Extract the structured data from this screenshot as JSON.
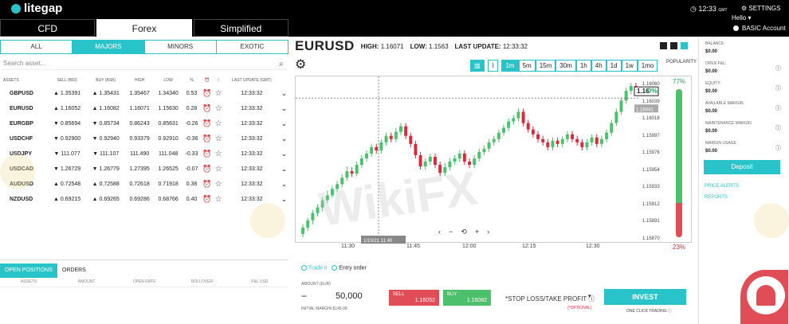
{
  "header": {
    "brand": "litegap",
    "time": "12:33",
    "tz": "GMT",
    "settings_label": "SETTINGS",
    "hello": "Hello",
    "account": "BASIC Account"
  },
  "main_tabs": [
    "CFD",
    "Forex",
    "Simplified"
  ],
  "sub_tabs": [
    "ALL",
    "MAJORS",
    "MINORS",
    "EXOTIC"
  ],
  "search": {
    "placeholder": "Search asset..."
  },
  "columns": [
    "ASSETS",
    "SELL (BID)",
    "BUY (ASK)",
    "HIGH",
    "LOW",
    "%",
    "",
    "",
    "LAST UPDATE (GMT)",
    ""
  ],
  "rows": [
    {
      "sym": "GBPUSD",
      "sell": "1.35391",
      "buy": "1.35431",
      "high": "1.35467",
      "low": "1.34340",
      "pct": "0.53",
      "time": "12:33:32",
      "sdir": "up",
      "bdir": "up"
    },
    {
      "sym": "EURUSD",
      "sell": "1.16052",
      "buy": "1.16082",
      "high": "1.16071",
      "low": "1.15630",
      "pct": "0.28",
      "time": "12:33:32",
      "sdir": "up",
      "bdir": "up"
    },
    {
      "sym": "EURGBP",
      "sell": "0.85694",
      "buy": "0.85734",
      "high": "0.86243",
      "low": "0.85631",
      "pct": "-0.26",
      "time": "12:33:32",
      "sdir": "down",
      "bdir": "down"
    },
    {
      "sym": "USDCHF",
      "sell": "0.92900",
      "buy": "0.92940",
      "high": "0.93379",
      "low": "0.92910",
      "pct": "-0.36",
      "time": "12:33:32",
      "sdir": "down",
      "bdir": "down"
    },
    {
      "sym": "USDJPY",
      "sell": "111.077",
      "buy": "111.107",
      "high": "111.490",
      "low": "111.048",
      "pct": "-0.33",
      "time": "12:33:32",
      "sdir": "down",
      "bdir": "down"
    },
    {
      "sym": "USDCAD",
      "sell": "1.26729",
      "buy": "1.26779",
      "high": "1.27395",
      "low": "1.26525",
      "pct": "-0.07",
      "time": "12:33:32",
      "sdir": "down",
      "bdir": "down"
    },
    {
      "sym": "AUDUSD",
      "sell": "0.72548",
      "buy": "0.72588",
      "high": "0.72618",
      "low": "0.71918",
      "pct": "0.38",
      "time": "12:33:32",
      "sdir": "up",
      "bdir": "up"
    },
    {
      "sym": "NZDUSD",
      "sell": "0.69215",
      "buy": "0.69265",
      "high": "0.69286",
      "low": "0.68766",
      "pct": "0.40",
      "time": "12:33:32",
      "sdir": "up",
      "bdir": "up"
    }
  ],
  "positions": {
    "tabs": [
      "OPEN POSITIONS",
      "ORDERS"
    ],
    "columns": [
      "ASSETS",
      "AMOUNT",
      "OPEN RATE",
      "ROLLOVER",
      "P&L USD"
    ]
  },
  "chart_head": {
    "symbol": "EURUSD",
    "high_label": "HIGH:",
    "high": "1.16071",
    "low_label": "LOW:",
    "low": "1.1563",
    "update_label": "LAST UPDATE:",
    "update": "12:33:32"
  },
  "timeframes": [
    "1m",
    "5m",
    "15m",
    "30m",
    "1h",
    "4h",
    "1d",
    "1w",
    "1mo"
  ],
  "popularity": {
    "label": "POPULARITY",
    "buy_pct": 77,
    "sell_pct": 23,
    "top": "77%",
    "bottom": "23%"
  },
  "order": {
    "tradeit": "Trade it",
    "entry": "Entry order",
    "amount_label": "AMOUNT (EUR)",
    "amount": "50,000",
    "minus": "−",
    "plus": "+",
    "initial_margin": "INITIAL MARGIN $145.08",
    "sell_label": "SELL",
    "sell_price": "1.16052",
    "buy_label": "BUY",
    "buy_price": "1.16082",
    "sltp": "STOP LOSS/TAKE PROFIT",
    "optional": "(*OPTIONAL)",
    "invest": "INVEST",
    "oneclick": "ONE CLICK TRADING"
  },
  "account": {
    "items": [
      {
        "label": "BALANCE:",
        "value": "$0.00"
      },
      {
        "label": "OPEN P&L:",
        "value": "$0.00"
      },
      {
        "label": "EQUITY:",
        "value": "$0.00"
      },
      {
        "label": "AVAILABLE MARGIN",
        "value": "$0.00"
      },
      {
        "label": "MAINTENANCE MARGIN",
        "value": "$0.00"
      },
      {
        "label": "MARGIN USAGE",
        "value": "$0.00"
      }
    ],
    "deposit": "Deposit",
    "price_alerts": "PRICE ALERTS",
    "reports": "REPORTS"
  },
  "watermark": "WikiFX",
  "chart_data": {
    "type": "candlestick",
    "y_ticks": [
      "1.16060",
      "1.16039",
      "1.16018",
      "1.15997",
      "1.15976",
      "1.15954",
      "1.15933",
      "1.15912",
      "1.15891",
      "1.15870"
    ],
    "x_ticks": [
      "11:30",
      "11:45",
      "12:00",
      "12:15",
      "12:30"
    ],
    "last_price_label": "1.16",
    "last_price_pct": "0%",
    "crosshair_price": "1.16041",
    "crosshair_time": "1/10/21 11:40",
    "candles": [
      [
        1.15872,
        1.1588,
        1.15868,
        1.15884
      ],
      [
        1.1588,
        1.15889,
        1.15876,
        1.15892
      ],
      [
        1.15889,
        1.15898,
        1.15884,
        1.15902
      ],
      [
        1.15898,
        1.15905,
        1.15894,
        1.15909
      ],
      [
        1.15905,
        1.15914,
        1.159,
        1.15918
      ],
      [
        1.15914,
        1.1592,
        1.1591,
        1.15926
      ],
      [
        1.1592,
        1.15928,
        1.15917,
        1.15932
      ],
      [
        1.15928,
        1.15934,
        1.15924,
        1.15938
      ],
      [
        1.15934,
        1.15942,
        1.1593,
        1.15946
      ],
      [
        1.15942,
        1.1595,
        1.15938,
        1.15956
      ],
      [
        1.1595,
        1.15947,
        1.15943,
        1.15955
      ],
      [
        1.15947,
        1.15958,
        1.15944,
        1.15962
      ],
      [
        1.15958,
        1.15966,
        1.15954,
        1.1597
      ],
      [
        1.15966,
        1.15972,
        1.15962,
        1.15976
      ],
      [
        1.15972,
        1.1598,
        1.15968,
        1.15984
      ],
      [
        1.1598,
        1.15976,
        1.15972,
        1.15984
      ],
      [
        1.15976,
        1.15986,
        1.15972,
        1.1599
      ],
      [
        1.15986,
        1.15994,
        1.15982,
        1.15998
      ],
      [
        1.15994,
        1.1599,
        1.15986,
        1.15998
      ],
      [
        1.1599,
        1.15999,
        1.15986,
        1.16004
      ],
      [
        1.15999,
        1.16006,
        1.15995,
        1.1601
      ],
      [
        1.16006,
        1.15994,
        1.1599,
        1.1601
      ],
      [
        1.15994,
        1.15984,
        1.1598,
        1.15998
      ],
      [
        1.15984,
        1.1597,
        1.15966,
        1.15988
      ],
      [
        1.1597,
        1.15956,
        1.15952,
        1.15974
      ],
      [
        1.15956,
        1.15962,
        1.15952,
        1.15966
      ],
      [
        1.15962,
        1.15968,
        1.15958,
        1.15972
      ],
      [
        1.15968,
        1.15958,
        1.15954,
        1.15972
      ],
      [
        1.15958,
        1.15948,
        1.15944,
        1.15962
      ],
      [
        1.15948,
        1.15955,
        1.15944,
        1.1596
      ],
      [
        1.15955,
        1.15962,
        1.15951,
        1.15966
      ],
      [
        1.15962,
        1.15966,
        1.15958,
        1.1597
      ],
      [
        1.15966,
        1.15972,
        1.15962,
        1.15976
      ],
      [
        1.15972,
        1.15962,
        1.15958,
        1.15976
      ],
      [
        1.15962,
        1.15958,
        1.15954,
        1.15966
      ],
      [
        1.15958,
        1.15966,
        1.15954,
        1.1597
      ],
      [
        1.15966,
        1.15974,
        1.15962,
        1.15978
      ],
      [
        1.15974,
        1.15978,
        1.1597,
        1.15982
      ],
      [
        1.15978,
        1.15986,
        1.15974,
        1.1599
      ],
      [
        1.15986,
        1.1599,
        1.15982,
        1.15994
      ],
      [
        1.1599,
        1.15998,
        1.15986,
        1.16002
      ],
      [
        1.15998,
        1.16004,
        1.15994,
        1.16008
      ],
      [
        1.16004,
        1.16012,
        1.16,
        1.16016
      ],
      [
        1.16012,
        1.16016,
        1.16008,
        1.1602
      ],
      [
        1.16016,
        1.16024,
        1.16012,
        1.16028
      ],
      [
        1.16024,
        1.1601,
        1.16006,
        1.16028
      ],
      [
        1.1601,
        1.16002,
        1.15998,
        1.16014
      ],
      [
        1.16002,
        1.15996,
        1.15992,
        1.16006
      ],
      [
        1.15996,
        1.1599,
        1.15986,
        1.16
      ],
      [
        1.1599,
        1.15986,
        1.15982,
        1.15994
      ],
      [
        1.15986,
        1.1598,
        1.15976,
        1.1599
      ],
      [
        1.1598,
        1.15988,
        1.15976,
        1.15992
      ],
      [
        1.15988,
        1.15984,
        1.1598,
        1.15992
      ],
      [
        1.15984,
        1.1599,
        1.1598,
        1.15994
      ],
      [
        1.1599,
        1.15996,
        1.15986,
        1.16
      ],
      [
        1.15996,
        1.1599,
        1.15986,
        1.16
      ],
      [
        1.1599,
        1.15986,
        1.15982,
        1.15994
      ],
      [
        1.15986,
        1.1598,
        1.15976,
        1.1599
      ],
      [
        1.1598,
        1.15986,
        1.15976,
        1.1599
      ],
      [
        1.15986,
        1.15992,
        1.15982,
        1.15996
      ],
      [
        1.15992,
        1.15984,
        1.1598,
        1.15996
      ],
      [
        1.15984,
        1.1599,
        1.1598,
        1.15994
      ],
      [
        1.1599,
        1.15998,
        1.15986,
        1.16002
      ],
      [
        1.15998,
        1.1601,
        1.15994,
        1.16014
      ],
      [
        1.1601,
        1.16024,
        1.16006,
        1.16028
      ],
      [
        1.16024,
        1.16038,
        1.1602,
        1.16042
      ],
      [
        1.16038,
        1.1605,
        1.16034,
        1.16054
      ],
      [
        1.1605,
        1.16056,
        1.16046,
        1.1606
      ],
      [
        1.16056,
        1.1605,
        1.16046,
        1.1606
      ]
    ]
  }
}
